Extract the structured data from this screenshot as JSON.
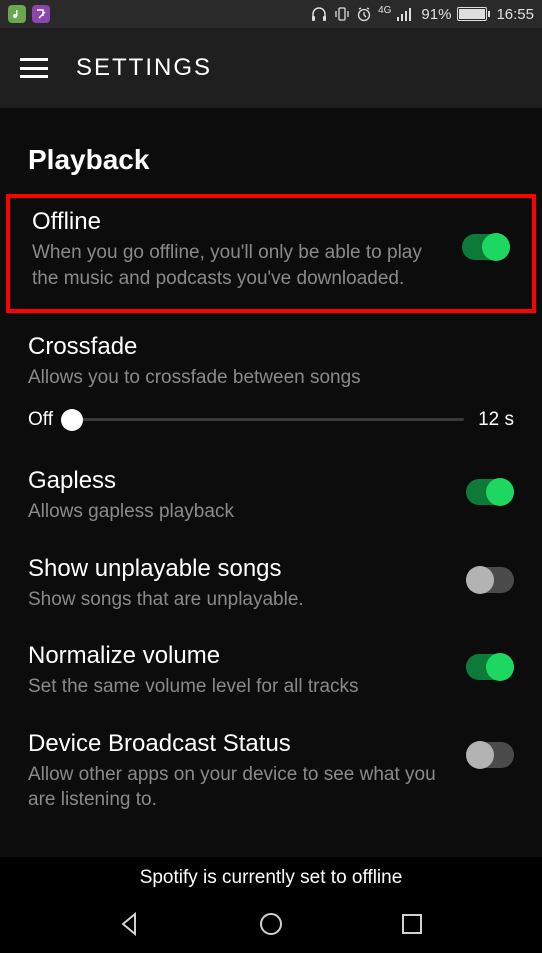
{
  "statusbar": {
    "battery_pct": "91%",
    "time": "16:55",
    "network": "4G"
  },
  "header": {
    "title": "SETTINGS"
  },
  "section": {
    "title": "Playback"
  },
  "settings": {
    "offline": {
      "label": "Offline",
      "desc": "When you go offline, you'll only be able to play the music and podcasts you've downloaded.",
      "on": true
    },
    "crossfade": {
      "label": "Crossfade",
      "desc": "Allows you to crossfade between songs",
      "slider_min_label": "Off",
      "slider_max_label": "12 s",
      "slider_value": 0
    },
    "gapless": {
      "label": "Gapless",
      "desc": "Allows gapless playback",
      "on": true
    },
    "unplayable": {
      "label": "Show unplayable songs",
      "desc": "Show songs that are unplayable.",
      "on": false
    },
    "normalize": {
      "label": "Normalize volume",
      "desc": "Set the same volume level for all tracks",
      "on": true
    },
    "broadcast": {
      "label": "Device Broadcast Status",
      "desc": "Allow other apps on your device to see what you are listening to.",
      "on": false
    }
  },
  "caption": "Spotify is currently set to offline"
}
